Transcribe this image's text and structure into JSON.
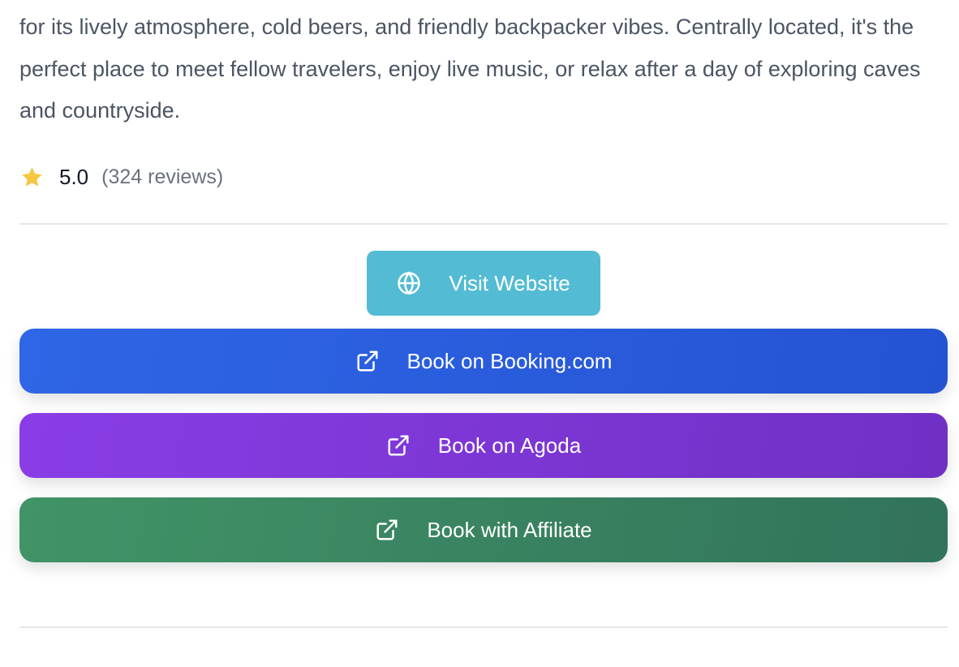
{
  "description": "for its lively atmosphere, cold beers, and friendly backpacker vibes. Centrally located, it's the perfect place to meet fellow travelers, enjoy live music, or relax after a day of exploring caves and countryside.",
  "rating": {
    "score": "5.0",
    "reviews": "(324 reviews)",
    "star_color": "#f5c842"
  },
  "buttons": {
    "visit": {
      "label": "Visit Website",
      "icon": "globe-icon",
      "color": "#53bbd3"
    },
    "booking": {
      "label": "Book on Booking.com",
      "icon": "external-link-icon",
      "color": "#2b5fdf"
    },
    "agoda": {
      "label": "Book on Agoda",
      "icon": "external-link-icon",
      "color": "#7d37d8"
    },
    "affiliate": {
      "label": "Book with Affiliate",
      "icon": "external-link-icon",
      "color": "#3a8660"
    }
  }
}
